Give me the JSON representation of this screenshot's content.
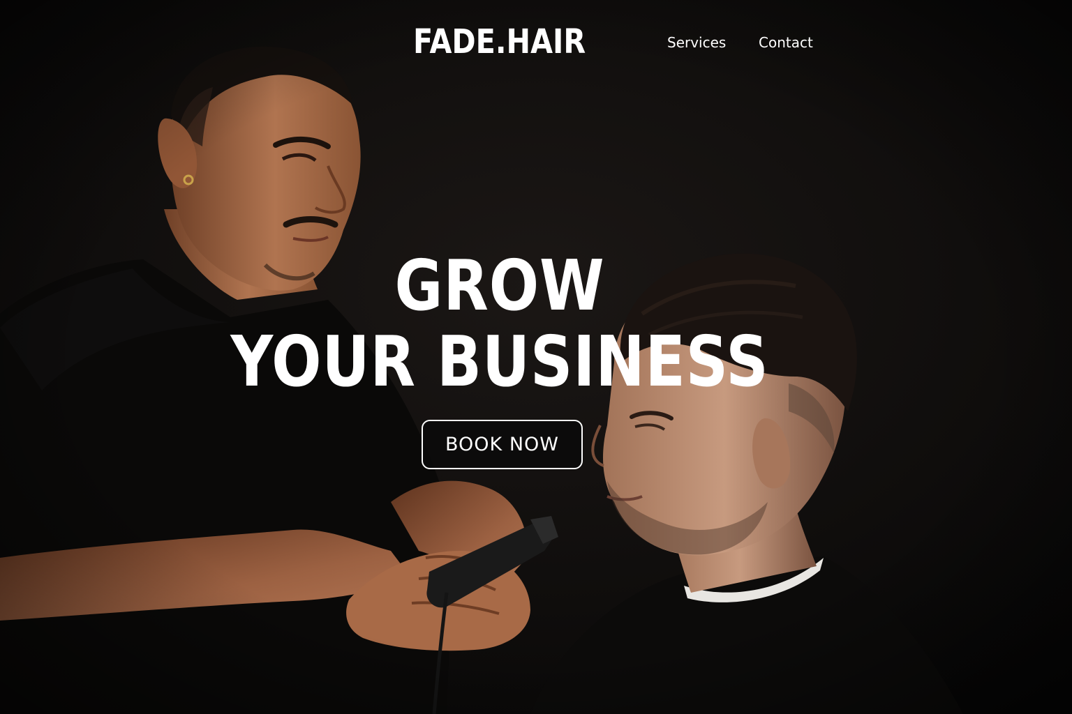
{
  "header": {
    "logo_text": "FADE.HAIR",
    "nav": [
      {
        "label": "Services"
      },
      {
        "label": "Contact"
      }
    ]
  },
  "hero": {
    "headline_line1": "GROW",
    "headline_line2": "YOUR BUSINESS",
    "cta_label": "BOOK NOW",
    "photo_description_icon": "barber-photo"
  },
  "colors": {
    "background": "#0b0b0b",
    "text": "#ffffff",
    "skin": "#a8704e",
    "hair": "#1b1410",
    "shirt": "#0a0a0a"
  }
}
